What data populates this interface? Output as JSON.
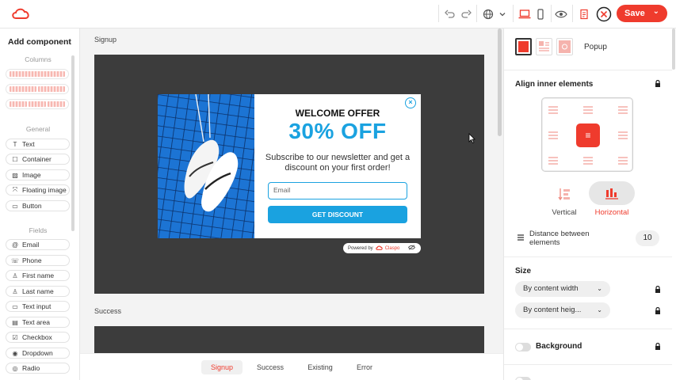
{
  "topbar": {
    "save_label": "Save"
  },
  "sidebar": {
    "title": "Add component",
    "sections": {
      "columns": "Columns",
      "general": "General",
      "fields": "Fields"
    },
    "general_items": [
      {
        "label": "Text",
        "icon": "T"
      },
      {
        "label": "Container",
        "icon": "☐"
      },
      {
        "label": "Image",
        "icon": "▨"
      },
      {
        "label": "Floating image",
        "icon": "⤧"
      },
      {
        "label": "Button",
        "icon": "▭"
      }
    ],
    "field_items": [
      {
        "label": "Email",
        "icon": "@"
      },
      {
        "label": "Phone",
        "icon": "☏"
      },
      {
        "label": "First name",
        "icon": "♙"
      },
      {
        "label": "Last name",
        "icon": "♙"
      },
      {
        "label": "Text input",
        "icon": "▭"
      },
      {
        "label": "Text area",
        "icon": "▤"
      },
      {
        "label": "Checkbox",
        "icon": "☑"
      },
      {
        "label": "Dropdown",
        "icon": "◉"
      },
      {
        "label": "Radio",
        "icon": "◎"
      }
    ]
  },
  "canvas": {
    "signup_label": "Signup",
    "success_label": "Success",
    "popup": {
      "title": "WELCOME OFFER",
      "headline": "30% OFF",
      "subtitle": "Subscribe to our newsletter and get a discount on your first order!",
      "email_placeholder": "Email",
      "button_label": "GET DISCOUNT",
      "powered_by": "Powered by",
      "brand": "Claspo"
    },
    "tabs": [
      "Signup",
      "Success",
      "Existing",
      "Error"
    ],
    "active_tab": "Signup"
  },
  "right_panel": {
    "popup_label": "Popup",
    "align_title": "Align inner elements",
    "vertical_label": "Vertical",
    "horizontal_label": "Horizontal",
    "active_direction": "Horizontal",
    "distance_label": "Distance between elements",
    "distance_value": "10",
    "size_title": "Size",
    "width_option": "By content width",
    "height_option": "By content heig...",
    "background_label": "Background",
    "accent_color": "#ef3b2d",
    "popup_color": "#1aa2e0"
  }
}
